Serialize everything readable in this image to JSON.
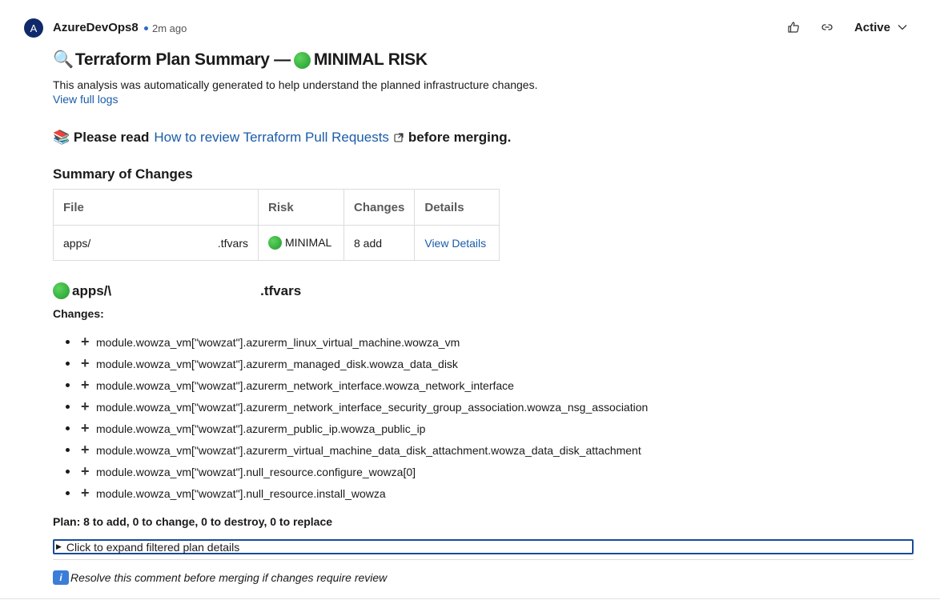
{
  "header": {
    "avatar_letter": "A",
    "author": "AzureDevOps8",
    "time": "2m ago",
    "status": "Active"
  },
  "comment": {
    "title_prefix": "🔍",
    "title": "Terraform Plan Summary —",
    "title_risk": "MINIMAL RISK",
    "intro": "This analysis was automatically generated to help understand the planned infrastructure changes.",
    "logs_link": "View full logs",
    "read_prefix": "📚 Please read",
    "read_link": "How to review Terraform Pull Requests",
    "read_suffix": "before merging.",
    "summary_heading": "Summary of Changes",
    "table": {
      "headers": [
        "File",
        "Risk",
        "Changes",
        "Details"
      ],
      "row": {
        "file_prefix": "apps/",
        "file_suffix": ".tfvars",
        "risk": "MINIMAL",
        "changes": "8 add",
        "details": "View Details"
      }
    },
    "file_heading_prefix": "apps/\\",
    "file_heading_suffix": ".tfvars",
    "changes_label": "Changes:",
    "changes": [
      "module.wowza_vm[\"wowzat\"].azurerm_linux_virtual_machine.wowza_vm",
      "module.wowza_vm[\"wowzat\"].azurerm_managed_disk.wowza_data_disk",
      "module.wowza_vm[\"wowzat\"].azurerm_network_interface.wowza_network_interface",
      "module.wowza_vm[\"wowzat\"].azurerm_network_interface_security_group_association.wowza_nsg_association",
      "module.wowza_vm[\"wowzat\"].azurerm_public_ip.wowza_public_ip",
      "module.wowza_vm[\"wowzat\"].azurerm_virtual_machine_data_disk_attachment.wowza_data_disk_attachment",
      "module.wowza_vm[\"wowzat\"].null_resource.configure_wowza[0]",
      "module.wowza_vm[\"wowzat\"].null_resource.install_wowza"
    ],
    "plan": "Plan: 8 to add, 0 to change, 0 to destroy, 0 to replace",
    "expand": "Click to expand filtered plan details",
    "note_icon": "i",
    "note": "Resolve this comment before merging if changes require review"
  }
}
